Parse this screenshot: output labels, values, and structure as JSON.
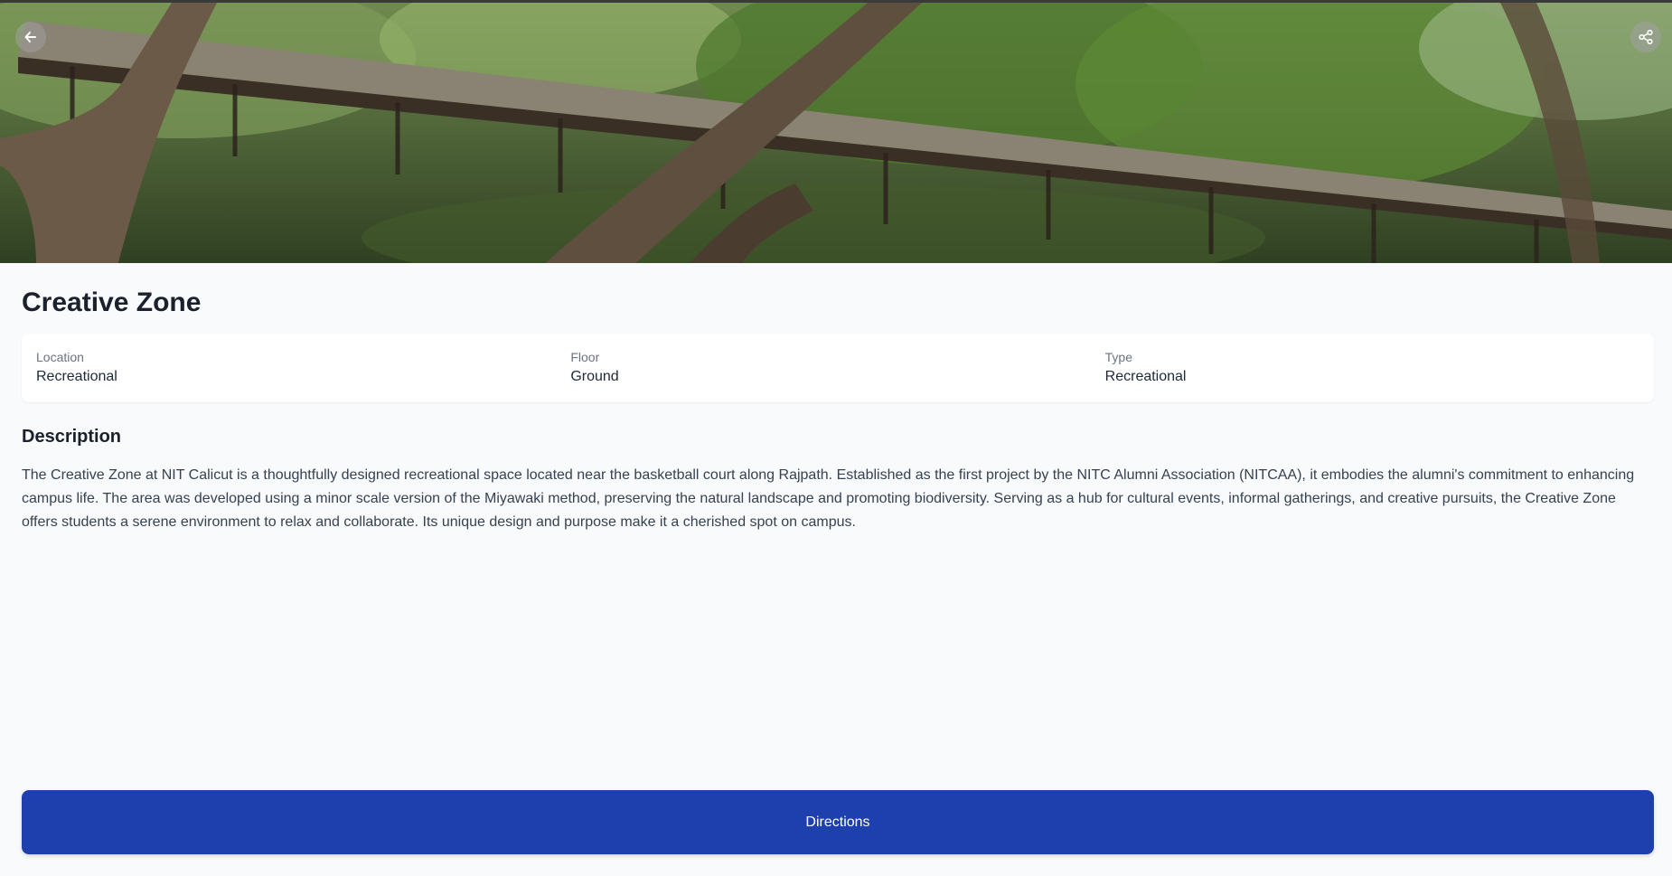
{
  "place": {
    "title": "Creative Zone"
  },
  "info": {
    "location_label": "Location",
    "location_value": "Recreational",
    "floor_label": "Floor",
    "floor_value": "Ground",
    "type_label": "Type",
    "type_value": "Recreational"
  },
  "description": {
    "heading": "Description",
    "text": "The Creative Zone at NIT Calicut is a thoughtfully designed recreational space located near the basketball court along Rajpath. Established as the first project by the NITC Alumni Association (NITCAA), it embodies the alumni's commitment to enhancing campus life. The area was developed using a minor scale version of the Miyawaki method, preserving the natural landscape and promoting biodiversity. Serving as a hub for cultural events, informal gatherings, and creative pursuits, the Creative Zone offers students a serene environment to relax and collaborate. Its unique design and purpose make it a cherished spot on campus."
  },
  "actions": {
    "directions_label": "Directions"
  },
  "icons": {
    "back": "arrow-left-icon",
    "share": "share-icon"
  },
  "colors": {
    "primary": "#1e40af",
    "background": "#f8fafc"
  }
}
